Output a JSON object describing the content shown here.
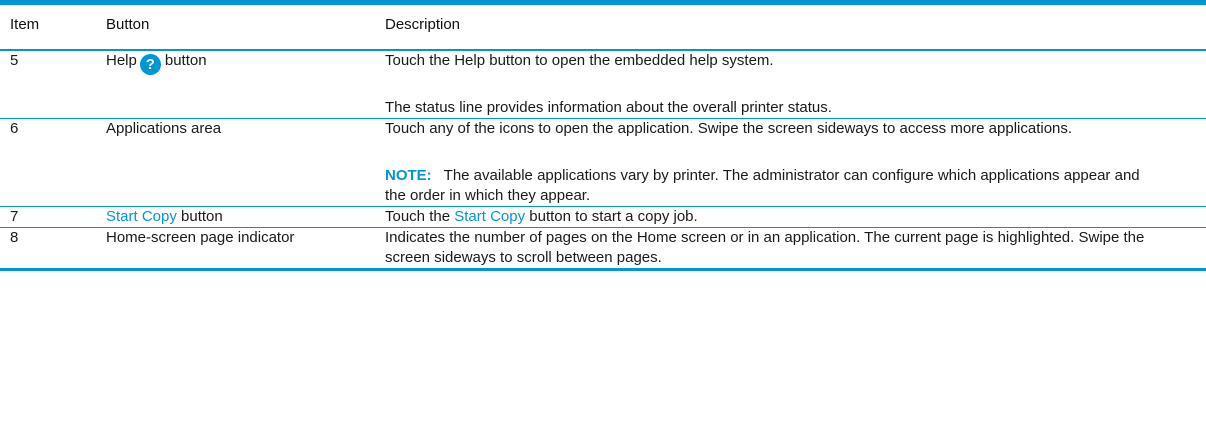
{
  "table": {
    "headers": {
      "item": "Item",
      "button": "Button",
      "description": "Description"
    },
    "rows": [
      {
        "item": "5",
        "button_before": "Help",
        "button_icon": "help-icon",
        "button_icon_glyph": "?",
        "button_after": "button",
        "desc1": "Touch the Help button to open the embedded help system.",
        "desc2": "The status line provides information about the overall printer status."
      },
      {
        "item": "6",
        "button": "Applications area",
        "desc1": "Touch any of the icons to open the application. Swipe the screen sideways to access more applications.",
        "note_label": "NOTE:",
        "note_text": "The available applications vary by printer. The administrator can configure which applications appear and the order in which they appear."
      },
      {
        "item": "7",
        "button_link": "Start Copy",
        "button_after": " button",
        "desc_before": "Touch the ",
        "desc_link": "Start Copy",
        "desc_after": " button to start a copy job."
      },
      {
        "item": "8",
        "button": "Home-screen page indicator",
        "desc1": "Indicates the number of pages on the Home screen or in an application. The current page is highlighted. Swipe the screen sideways to scroll between pages."
      }
    ]
  },
  "colors": {
    "accent": "#0096d6",
    "text": "#1a1a1a"
  }
}
